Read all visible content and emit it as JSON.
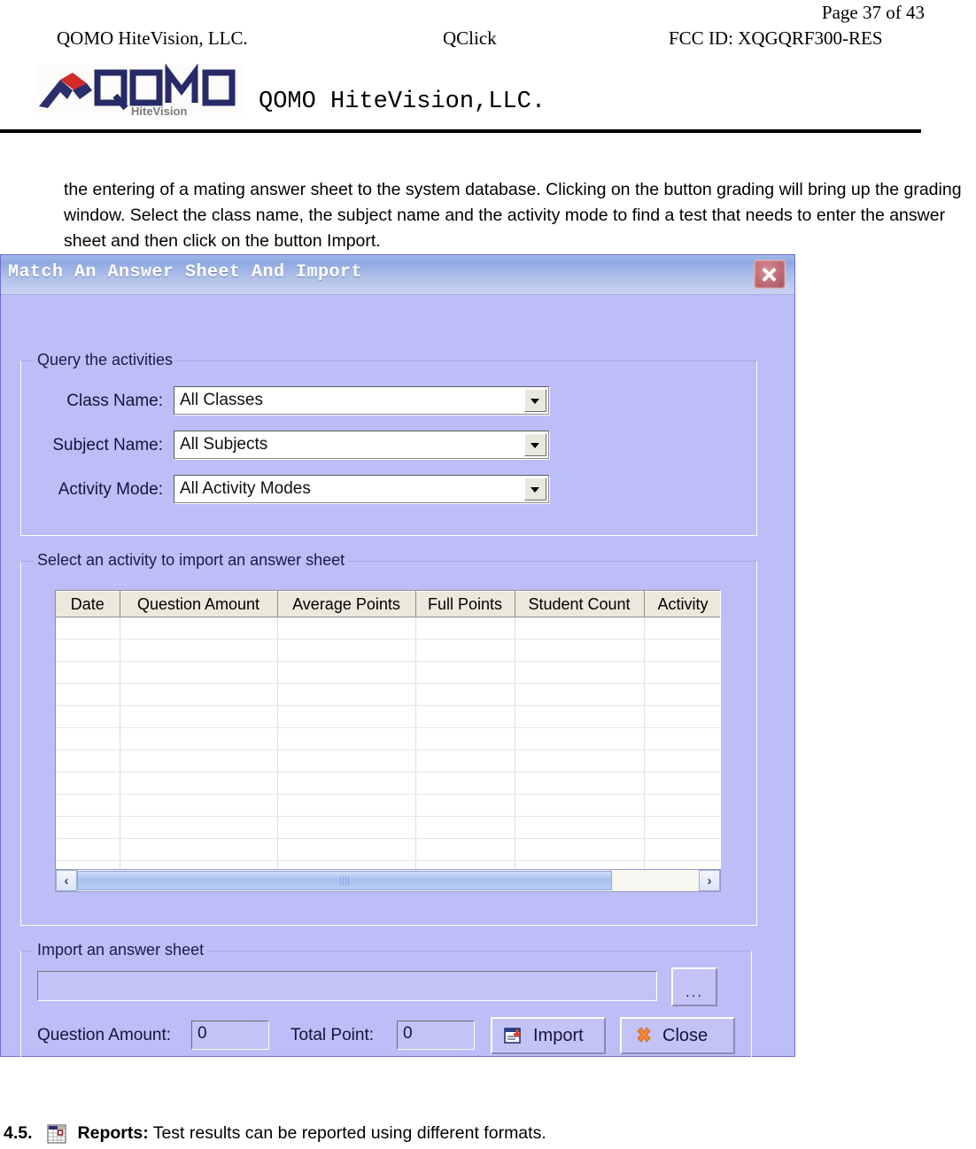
{
  "page_header": {
    "page_number": "Page 37 of 43",
    "company": "QOMO HiteVision, LLC.",
    "product": "QClick",
    "fcc_id": "FCC ID: XQGQRF300-RES",
    "brand_line": "QOMO HiteVision,LLC.",
    "logo_text": "QOMO",
    "logo_sub": "HiteVision"
  },
  "body": {
    "paragraph": "the entering of a mating answer sheet to the system database. Clicking on the button grading will bring up the grading window. Select the class name, the subject name and the activity mode to find a test that needs to enter the answer sheet and then click on the button Import."
  },
  "dialog": {
    "title": "Match An Answer Sheet And Import",
    "close_icon": "close-icon",
    "query_group": {
      "legend": "Query the activities",
      "fields": [
        {
          "label": "Class Name:",
          "value": "All Classes"
        },
        {
          "label": "Subject Name:",
          "value": "All Subjects"
        },
        {
          "label": "Activity Mode:",
          "value": "All Activity Modes"
        }
      ]
    },
    "select_group": {
      "legend": "Select an activity to import an answer sheet",
      "columns": [
        "Date",
        "Question Amount",
        "Average Points",
        "Full Points",
        "Student Count",
        "Activity"
      ],
      "rows": [],
      "empty_row_count": 13,
      "scrollbar": {
        "left_arrow": "‹",
        "right_arrow": "›"
      }
    },
    "import_group": {
      "legend": "Import an answer sheet",
      "path_value": "",
      "browse_label": "...",
      "question_amount_label": "Question Amount:",
      "question_amount_value": "0",
      "total_point_label": "Total Point:",
      "total_point_value": "0",
      "import_label": "Import",
      "close_label": "Close"
    }
  },
  "footer": {
    "number": "4.5.",
    "icon": "reports-grid-icon",
    "strong": "Reports:",
    "text": "Test results can be reported using different formats."
  },
  "colors": {
    "dialog_bg": "#bdbdf7",
    "titlebar": "#8fa8e2",
    "grid_header": "#ece9dc",
    "accent_red": "#b9434f"
  }
}
